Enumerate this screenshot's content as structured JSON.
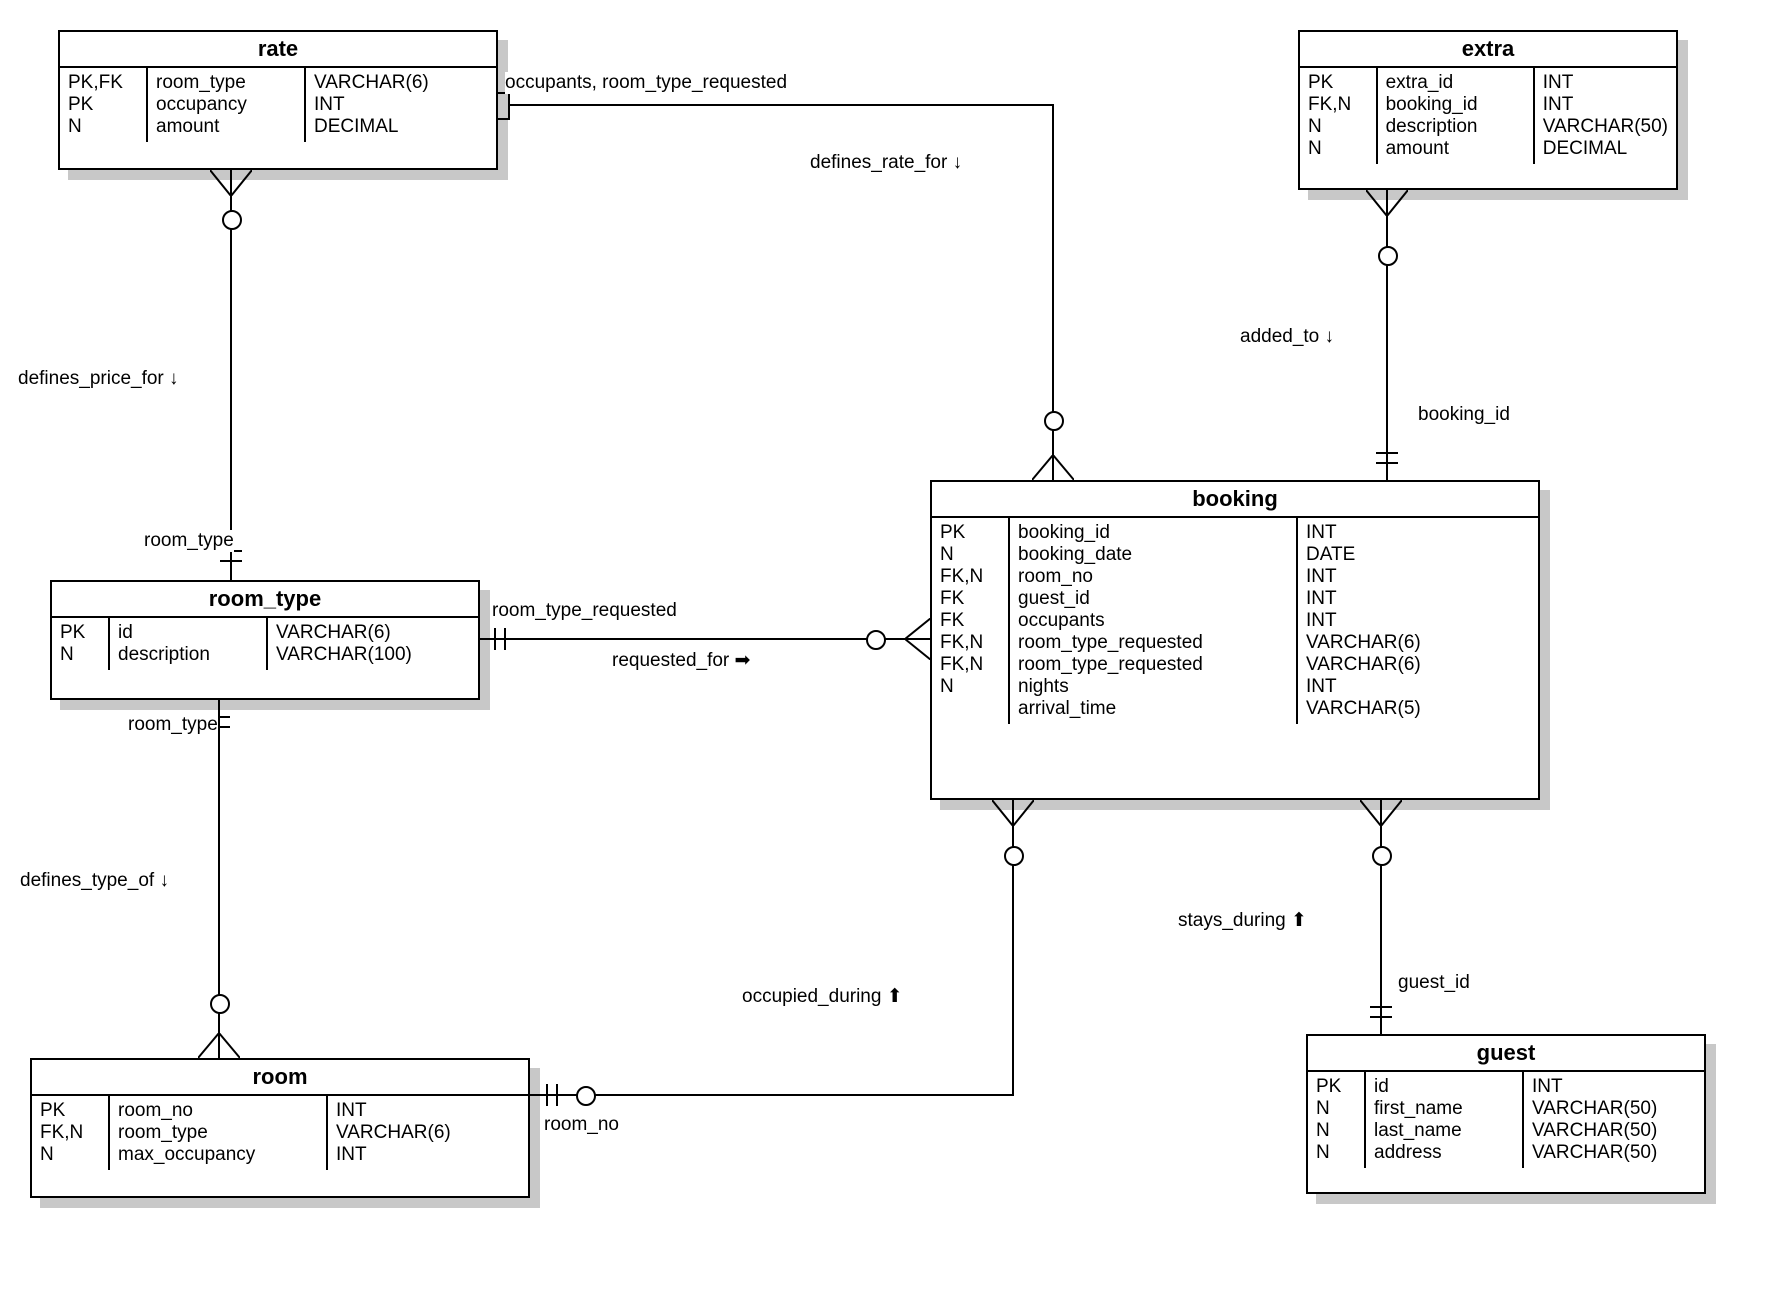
{
  "entities": {
    "rate": {
      "title": "rate",
      "keys": [
        "PK,FK",
        "PK",
        "N"
      ],
      "names": [
        "room_type",
        "occupancy",
        "amount"
      ],
      "types": [
        "VARCHAR(6)",
        "INT",
        "DECIMAL"
      ]
    },
    "extra": {
      "title": "extra",
      "keys": [
        "PK",
        "FK,N",
        "N",
        "N"
      ],
      "names": [
        "extra_id",
        "booking_id",
        "description",
        "amount"
      ],
      "types": [
        "INT",
        "INT",
        "VARCHAR(50)",
        "DECIMAL"
      ]
    },
    "room_type": {
      "title": "room_type",
      "keys": [
        "PK",
        "N"
      ],
      "names": [
        "id",
        "description"
      ],
      "types": [
        "VARCHAR(6)",
        "VARCHAR(100)"
      ]
    },
    "booking": {
      "title": "booking",
      "keys": [
        "PK",
        "N",
        "FK,N",
        "FK",
        "FK",
        "FK,N",
        "FK,N",
        "",
        "N"
      ],
      "names": [
        "booking_id",
        "booking_date",
        "room_no",
        "guest_id",
        "occupants",
        "room_type_requested",
        "room_type_requested",
        "nights",
        "arrival_time"
      ],
      "types": [
        "INT",
        "DATE",
        "INT",
        "INT",
        "INT",
        "VARCHAR(6)",
        "VARCHAR(6)",
        "INT",
        "VARCHAR(5)"
      ]
    },
    "room": {
      "title": "room",
      "keys": [
        "PK",
        "FK,N",
        "N"
      ],
      "names": [
        "room_no",
        "room_type",
        "max_occupancy"
      ],
      "types": [
        "INT",
        "VARCHAR(6)",
        "INT"
      ]
    },
    "guest": {
      "title": "guest",
      "keys": [
        "PK",
        "N",
        "N",
        "N"
      ],
      "names": [
        "id",
        "first_name",
        "last_name",
        "address"
      ],
      "types": [
        "INT",
        "VARCHAR(50)",
        "VARCHAR(50)",
        "VARCHAR(50)"
      ]
    }
  },
  "relations": {
    "defines_rate_for": "defines_rate_for ↓",
    "defines_price_for": "defines_price_for ↓",
    "room_type_top": "room_type",
    "room_type_requested": "room_type_requested",
    "requested_for": "requested_for ➡",
    "added_to": "added_to ↓",
    "booking_id": "booking_id",
    "occupants_rtr": "occupants, room_type_requested",
    "room_type_bottom": "room_type",
    "defines_type_of": "defines_type_of ↓",
    "occupied_during": "occupied_during ⬆",
    "room_no": "room_no",
    "stays_during": "stays_during ⬆",
    "guest_id": "guest_id"
  }
}
